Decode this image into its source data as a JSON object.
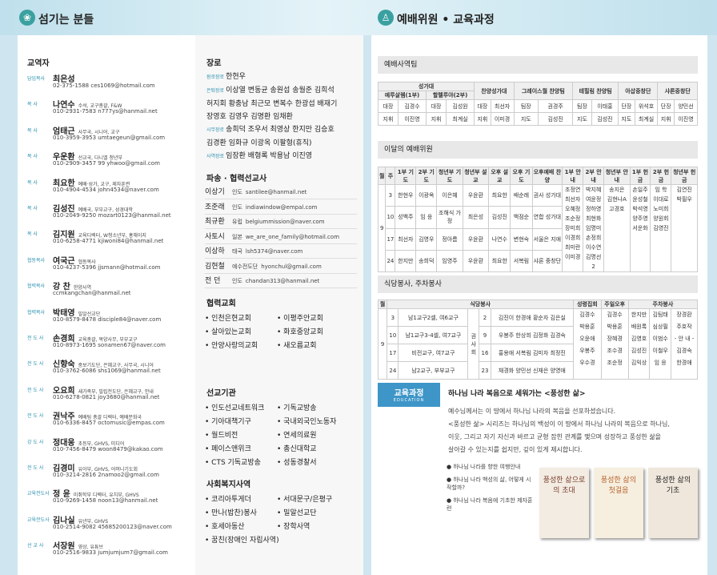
{
  "header": {
    "left_title": "섬기는 분들",
    "right_title": "예배위원 • 교육과정"
  },
  "staff": {
    "title": "교역자",
    "items": [
      {
        "role": "담임목사",
        "name": "최은성",
        "desc": "",
        "contact": "02-375-1588  ces1069@hotmail.com"
      },
      {
        "role": "목    사",
        "name": "나연수",
        "desc": "수석, 교구총괄, F&W",
        "contact": "010-2931-7583  n777ys@hanmail.net"
      },
      {
        "role": "목    사",
        "name": "엄태근",
        "desc": "사무국, 시니어, 교구",
        "contact": "010-3959-3953  umtaegeun@gmail.com"
      },
      {
        "role": "목    사",
        "name": "우운환",
        "desc": "선교국, 다니엘 청년부",
        "contact": "010-2909-3457 99  yhwoo@gmail.com"
      },
      {
        "role": "목    사",
        "name": "최요한",
        "desc": "예배·성가, 교구, 제자훈련",
        "contact": "010-4904-4534  john4534@naver.com"
      },
      {
        "role": "목    사",
        "name": "김성진",
        "desc": "예배국, 부부교구, 성경대학",
        "contact": "010-2049-9250  mozart0123@hanmail.net"
      },
      {
        "role": "목    사",
        "name": "김지원",
        "desc": "교육디렉터, W청소년부, 홍해이지",
        "contact": "010-6258-4771  kjiwoni84@hanmail.net"
      },
      {
        "role": "협동목사",
        "name": "여국근",
        "desc": "협동목사",
        "contact": "010-4237-5396  jjsmann@hotmail.com"
      },
      {
        "role": "협력목사",
        "name": "강   찬",
        "desc": "한양사역",
        "contact": "ccmkangchan@hanmail.net"
      },
      {
        "role": "협력목사",
        "name": "박태영",
        "desc": "밀알선교단",
        "contact": "010-8579-8478  disciple84@naver.com"
      },
      {
        "role": "전 도 사",
        "name": "손경희",
        "desc": "교육총괄, 목양사무, 부부교구",
        "contact": "010-8973-1695  sonamen67@naver.com"
      },
      {
        "role": "전 도 사",
        "name": "신향숙",
        "desc": "중보기도단, 은혜교구, 사무국, 시니어",
        "contact": "010-3762-6086  shs1069@hanmail.net"
      },
      {
        "role": "전 도 사",
        "name": "오요희",
        "desc": "새가족부, 빌립전도단, 은혜교구, 안내",
        "contact": "010-6278-0821  joy3680@hanmail.net"
      },
      {
        "role": "전 도 사",
        "name": "권낙주",
        "desc": "예배팀 총괄 디렉터, 예배문화국",
        "contact": "010-6336-8457  octomusic@empas.com"
      },
      {
        "role": "강 도 사",
        "name": "정대웅",
        "desc": "초등부, GHVS, 미디어",
        "contact": "010-7456-8479  woon8479@kakao.com"
      },
      {
        "role": "전 도 사",
        "name": "김경미",
        "desc": "유아부, GHVS, 어머니기도회",
        "contact": "010-3214-2816  2namoo2@gmail.com"
      },
      {
        "role": "교육전도사",
        "name": "정   윤",
        "desc": "미취학부 디렉터, 유치부, GHVS",
        "contact": "010-9269-1458  noon13@hanmail.net"
      },
      {
        "role": "교육전도사",
        "name": "김나실",
        "desc": "유년부, GHVS",
        "contact": "010-2514-9082  45685200123@naver.com"
      },
      {
        "role": "선 교 사",
        "name": "서장원",
        "desc": "영상, 유튜브",
        "contact": "010-2516-9833  jumjumjum7@gmail.com"
      }
    ]
  },
  "elders": {
    "title": "장로",
    "groups": [
      {
        "label": "원로장로",
        "lines": [
          "한현우"
        ]
      },
      {
        "label": "은퇴장로",
        "lines": [
          "이상열 변동균 송원섭 송월준 김희석",
          "허지회 황충남 최근모 변복수 한광섭 배재기",
          "장영호 김영우 김명환 임채환"
        ]
      },
      {
        "label": "시무장로",
        "lines": [
          "송희덕 조우서 최영상 한지만 김승호",
          "김경환 임화규 이광옥 이팔형(휴직)"
        ]
      },
      {
        "label": "사역장로",
        "lines": [
          "임장환 배형록 박용남 이진영"
        ]
      }
    ]
  },
  "missionaries": {
    "title": "파송 · 협력선교사",
    "items": [
      {
        "name": "이상기",
        "region": "인도",
        "email": "santilee@hanmail.net"
      },
      {
        "name": "조준래",
        "region": "인도",
        "email": "indiawindow@empal.com"
      },
      {
        "name": "최규환",
        "region": "유럽",
        "email": "belgiummission@naver.com"
      },
      {
        "name": "사토시",
        "region": "일본",
        "email": "we_are_one_family@hotmail.com"
      },
      {
        "name": "이상하",
        "region": "태국",
        "email": "lsh5374@naver.com"
      },
      {
        "name": "김현철",
        "region": "예수전도단",
        "email": "hyonchul@gmail.com"
      },
      {
        "name": "전   던",
        "region": "인도",
        "email": "chandan313@hanmail.net"
      }
    ]
  },
  "churches": {
    "title": "협력교회",
    "items": [
      "인천은현교회",
      "이평주안교회",
      "살아있는교회",
      "화호중앙교회",
      "안양사랑의교회",
      "새오름교회"
    ]
  },
  "institutions": {
    "title": "선교기관",
    "items": [
      "인도선교네트워크",
      "기독교방송",
      "기아대책기구",
      "국내외국인노동자",
      "월드비전",
      "연세의료원",
      "페이스앤위크",
      "총신대학교",
      "CTS 기독교방송",
      "성동경찰서"
    ]
  },
  "welfare": {
    "title": "사회복지사역",
    "items": [
      "코리아투게더",
      "서대문구/은평구",
      "만나(밥찬)봉사",
      "밀알선교단",
      "호세아동산",
      "장학사역",
      "꿈친(장애인 자립사역)"
    ]
  },
  "worship_team": {
    "title": "예배사역팀",
    "h1": [
      "성가대",
      "찬양성가대",
      "그레이스월 찬양팀",
      "테힐림 찬양팀",
      "아삽중창단",
      "샤론중창단"
    ],
    "h2": [
      "예루살렘(1부)",
      "할렐루야(2부)"
    ],
    "r1": [
      "대장",
      "김경수",
      "대장",
      "김성원",
      "대장",
      "최선자",
      "팀장",
      "권경주",
      "팀장",
      "이태홍",
      "단장",
      "위석호",
      "단장",
      "양민선"
    ],
    "r2": [
      "지휘",
      "이진영",
      "지휘",
      "최계실",
      "지휘",
      "이미경",
      "지도",
      "김성진",
      "지도",
      "김성진",
      "지도",
      "최계실",
      "지휘",
      "이진영"
    ]
  },
  "monthly": {
    "title": "이달의 예배위원",
    "headers": [
      "월",
      "주",
      "1부 기도",
      "2부 기도",
      "청년부 기도",
      "청년부 설교",
      "오후 설교",
      "오후 기도",
      "오후예배 찬양",
      "1부 안내",
      "2부 안내",
      "청년부 안내",
      "1부 헌금",
      "2부 헌금",
      "청년부 헌금"
    ],
    "month": "9",
    "rows": [
      [
        "3",
        "한현우",
        "이광옥",
        "이은혜",
        "우윤환",
        "최요한",
        "배순례",
        "권사 성가대"
      ],
      [
        "10",
        "성백주",
        "임 응",
        "조해식 가정",
        "최은성",
        "김성진",
        "백점순",
        "연합 성가대"
      ],
      [
        "17",
        "최선자",
        "김영우",
        "정아름",
        "우윤환",
        "나연수",
        "변현숙",
        "서울은 지애"
      ],
      [
        "24",
        "한지만",
        "송희덕",
        "임영주",
        "우윤환",
        "최요한",
        "서복림",
        "샤론 중창단"
      ]
    ],
    "ann1": [
      "조정연",
      "최선자",
      "오혜정",
      "조순정",
      "장미희",
      "이경희",
      "최미란",
      "이미경"
    ],
    "ann2": [
      "박지혜",
      "여윤정",
      "정하영",
      "최현화",
      "임명미",
      "손정희",
      "이수연",
      "김명선2"
    ],
    "ann3": [
      "송지은",
      "김현나A",
      "고경호"
    ],
    "off1": [
      "손일주",
      "윤성철",
      "박석영",
      "양주영",
      "서운화"
    ],
    "off2": [
      "임   학",
      "이대로",
      "노미희",
      "양원회",
      "김영진"
    ],
    "off3": [
      "김연진",
      "박필우"
    ]
  },
  "cafeteria": {
    "title": "식당봉사, 주차봉사",
    "headers": [
      "월",
      "식당봉사",
      "",
      "",
      "성령집회",
      "주일오후",
      "주차봉사"
    ],
    "month": "9",
    "side": "권사회",
    "rows": [
      [
        "3",
        "남1교구2셀, 여6교구",
        "2",
        "김진이 한경애 황순자 김은실"
      ],
      [
        "10",
        "남1교구3-4셀, 여7교구",
        "9",
        "우봉주 한상희 김정화 김경숙"
      ],
      [
        "17",
        "비전교구, 여7교구",
        "16",
        "홍용애 서복림 김미자 최정진"
      ],
      [
        "24",
        "남2교구, 부부교구",
        "23",
        "채경화 양민선 신재은 양영애"
      ]
    ],
    "spirit": [
      "김경수",
      "박용훈",
      "오윤애",
      "우봉주",
      "우수경"
    ],
    "sunday": [
      "김경수",
      "박용훈",
      "장혜경",
      "조수경",
      "조순정"
    ],
    "parking1": [
      "한지만",
      "배원록",
      "김영호",
      "김성진",
      "김익상"
    ],
    "parking2": [
      "김팀태",
      "심상필",
      "이범수",
      "이철우",
      "임   응"
    ],
    "parking3": [
      "장경환",
      "주호작",
      "- 안 내 -",
      "김경숙",
      "한경애"
    ]
  },
  "education": {
    "badge": "교육과정",
    "badge_sub": "EDUCATION",
    "heading": "하나님 나라 복음으로 세워가는 <풍성한 삶>",
    "body": [
      "예수님께서는 이 땅에서 하나님 나라의 복음을 선포하셨습니다.",
      "<풍성한 삶> 시리즈는 하나님의 백성이 이 땅에서 하나님 나라의 복음으로 하나님,",
      "이웃, 그리고 자기 자신과 바르고 균형 잡힌 관계를 맺으며 성장하고 풍성한 삶을",
      "살아갈 수 있는지를 쉽지만, 깊이 있게 제시합니다."
    ],
    "courses": [
      "하나님 나라를 향한 여행안내",
      "하나님 나라 백성의 삶, 어떻게 시작할까?",
      "하나님 나라 복음에 기초한 제자훈련"
    ],
    "books": [
      "풍성한 삶으로의 초대",
      "풍성한 삶의 첫걸음",
      "풍성한 삶의 기초"
    ]
  },
  "colors": {
    "accent": "#2b8fb0",
    "badge": "#3d95c8",
    "header_bg": "#cfe6f0"
  }
}
